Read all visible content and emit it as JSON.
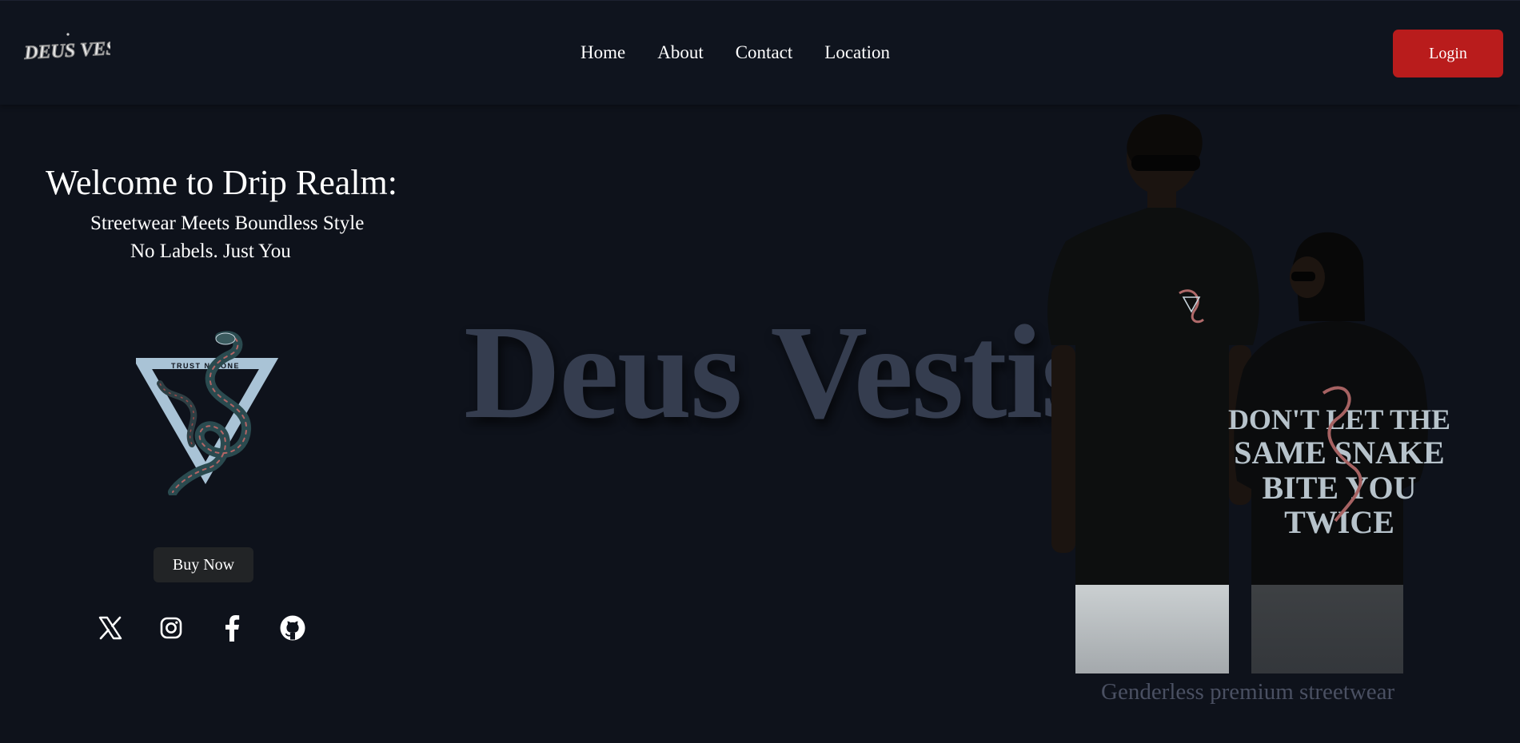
{
  "header": {
    "logo_text": "DEUS VESTIS",
    "nav": [
      {
        "label": "Home"
      },
      {
        "label": "About"
      },
      {
        "label": "Contact"
      },
      {
        "label": "Location"
      }
    ],
    "login_label": "Login"
  },
  "hero": {
    "title": "Welcome to Drip Realm:",
    "subtitle_1": "Streetwear Meets Boundless Style",
    "subtitle_2": "No Labels. Just You",
    "emblem_text": "TRUST NO ONE",
    "buy_label": "Buy Now",
    "socials": [
      {
        "icon": "x-icon"
      },
      {
        "icon": "instagram-icon"
      },
      {
        "icon": "facebook-icon"
      },
      {
        "icon": "github-icon"
      }
    ]
  },
  "brand": {
    "big_text": "Deus Vestis"
  },
  "showcase": {
    "shirt_back_text": "DON'T LET THE SAME SNAKE BITE YOU TWICE",
    "caption": "Genderless premium streetwear"
  },
  "colors": {
    "background": "#0e121b",
    "navbar": "#0f141e",
    "login": "#b91c1c",
    "buy": "#222426",
    "brand_text": "#353d4f",
    "caption": "#4a5062"
  }
}
